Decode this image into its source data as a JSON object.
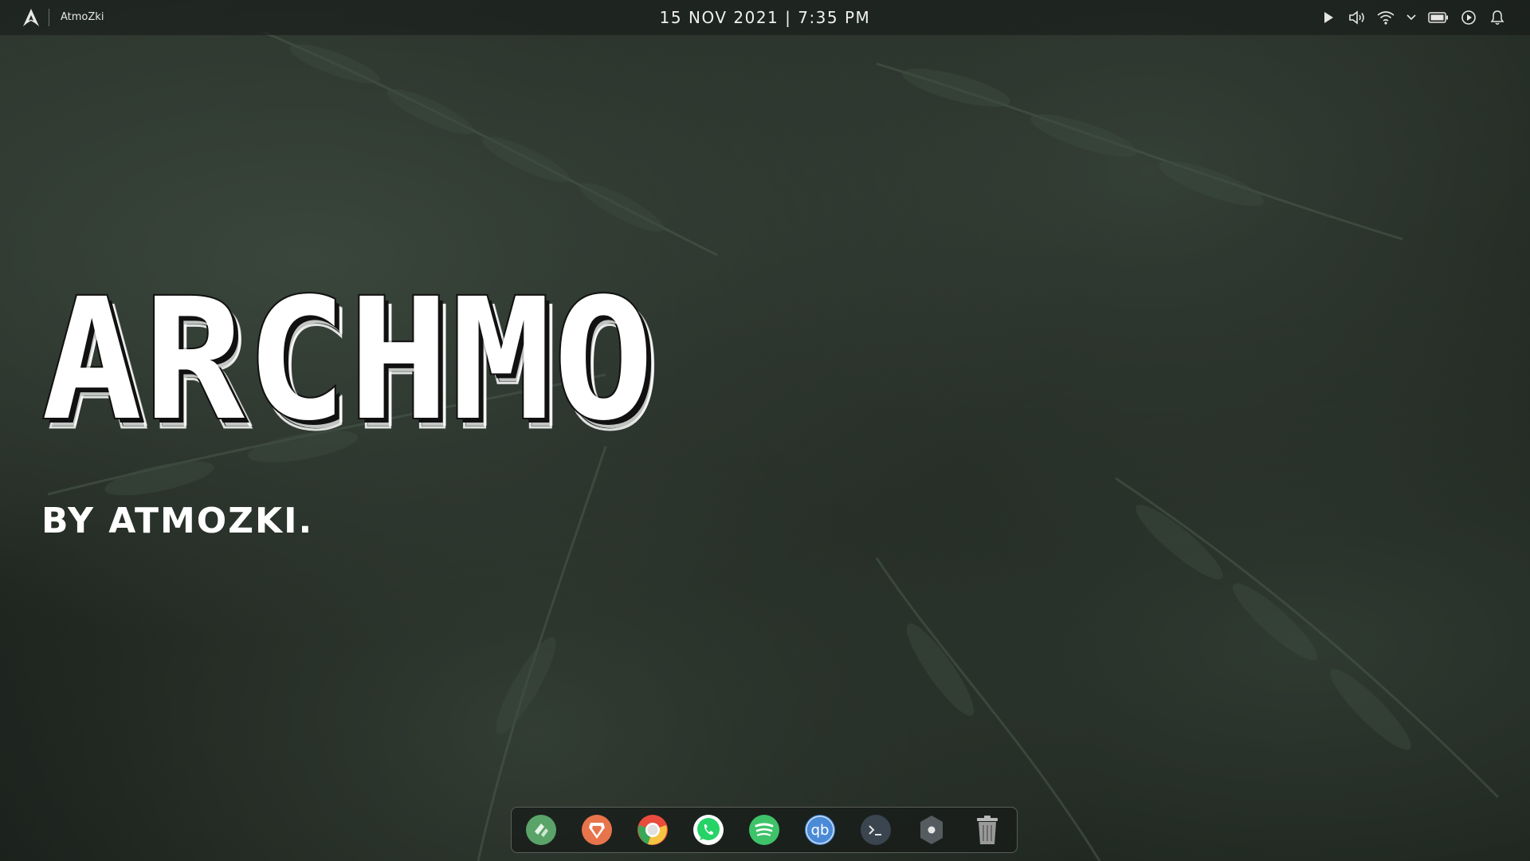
{
  "topbar": {
    "launcher_icon": "arch-logo-icon",
    "username": "AtmoZki",
    "clock": "15 NOV 2021 | 7:35 PM",
    "tray": [
      {
        "name": "media-play-icon"
      },
      {
        "name": "volume-icon"
      },
      {
        "name": "wifi-icon"
      },
      {
        "name": "chevron-down-icon"
      },
      {
        "name": "battery-icon"
      },
      {
        "name": "power-timer-icon"
      },
      {
        "name": "notification-bell-icon"
      }
    ]
  },
  "desktop": {
    "title": "ARCHMO",
    "subtitle": "BY ATMOZKI."
  },
  "dock": {
    "items": [
      {
        "name": "file-manager-icon",
        "color": "#5aa469"
      },
      {
        "name": "brave-browser-icon",
        "color": "#e8744b"
      },
      {
        "name": "chrome-browser-icon",
        "color": "#e9e9e9"
      },
      {
        "name": "whatsapp-icon",
        "color": "#25d366"
      },
      {
        "name": "spotify-icon",
        "color": "#3ec36a"
      },
      {
        "name": "qbittorrent-icon",
        "color": "#4a8ad6"
      },
      {
        "name": "terminal-icon",
        "color": "#3a4550"
      },
      {
        "name": "settings-icon",
        "color": "#555b5e"
      },
      {
        "name": "trash-icon",
        "color": "#9a9a9a"
      }
    ]
  },
  "colors": {
    "topbar_bg": "#141816",
    "text": "#ffffff",
    "wallpaper_base": "#1d231e"
  }
}
